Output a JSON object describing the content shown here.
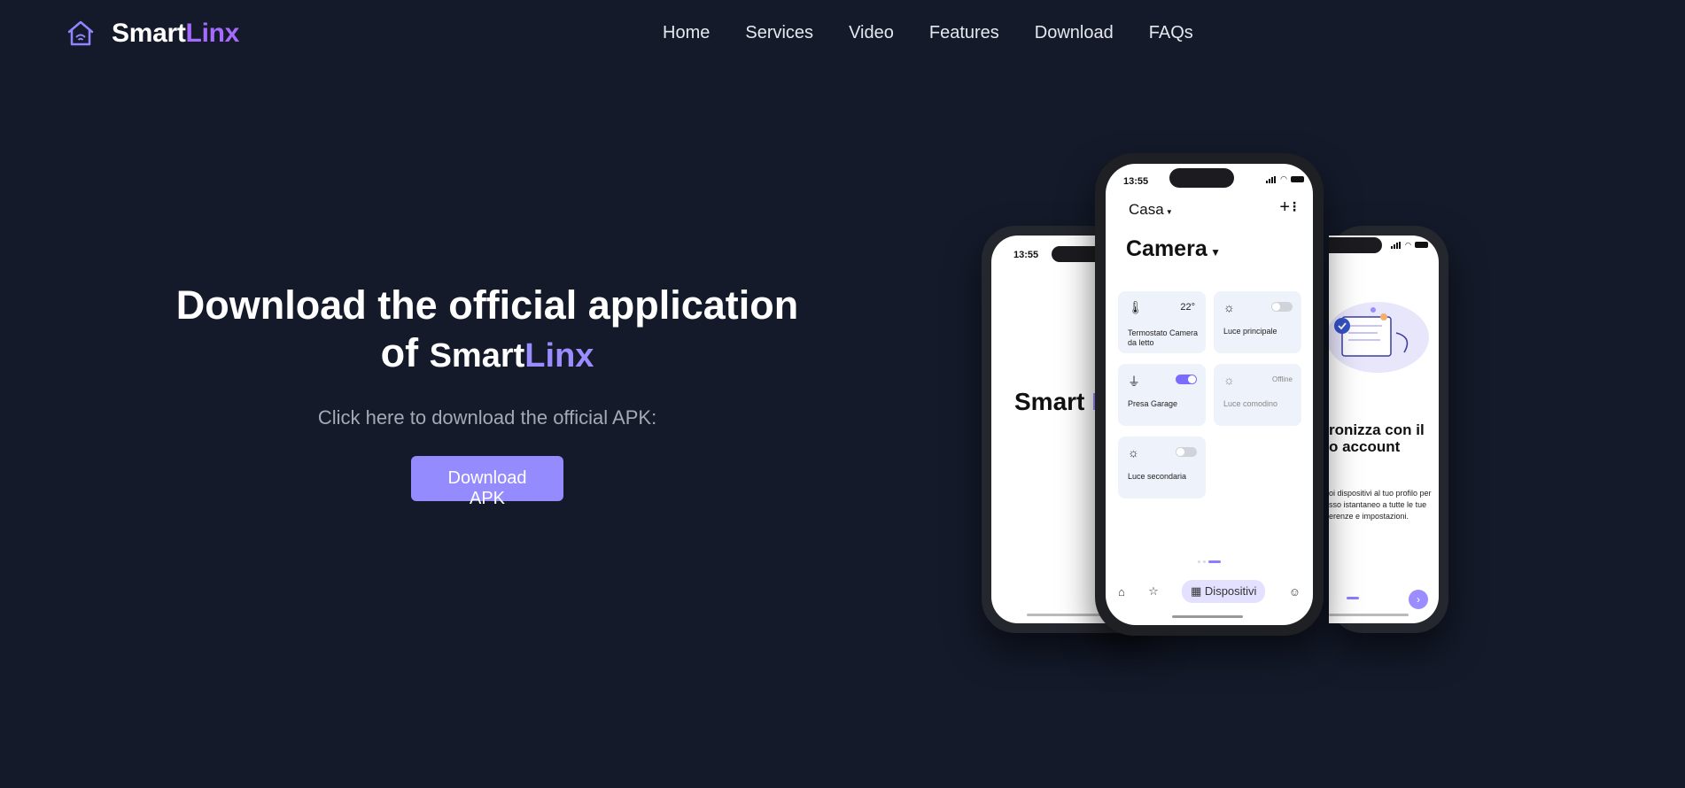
{
  "brand": {
    "part1": "Smart",
    "part2": "Linx",
    "accent": "#a56bff"
  },
  "nav": {
    "links": [
      "Home",
      "Services",
      "Video",
      "Features",
      "Download",
      "FAQs"
    ]
  },
  "hero": {
    "title_line1": "Download the official application",
    "title_of": "of",
    "subtitle": "Click here to download the official APK:",
    "button_label": "Download APK",
    "button_color": "#948bff"
  },
  "phone_left": {
    "time": "13:55",
    "brand_part1": "Smart",
    "brand_part2": "L"
  },
  "phone_center": {
    "time": "13:55",
    "home": "Casa",
    "room": "Camera",
    "cards": [
      {
        "label": "Termostato Camera da letto",
        "value": "22°",
        "icon": "thermometer-icon"
      },
      {
        "label": "Luce principale",
        "icon": "light-icon",
        "toggle": "off"
      },
      {
        "label": "Presa Garage",
        "icon": "plug-icon",
        "toggle": "on"
      },
      {
        "label": "Luce comodino",
        "icon": "light-icon",
        "status": "Offline"
      },
      {
        "label": "Luce secondaria",
        "icon": "light-icon",
        "toggle": "off"
      }
    ],
    "tab_active": "Dispositivi"
  },
  "phone_right": {
    "title_line1": "ronizza con il",
    "title_line2": "o account",
    "body_line1": "oi dispositivi al tuo profilo per",
    "body_line2": "sso istantaneo a tutte le tue",
    "body_line3": "erenze e impostazioni."
  }
}
